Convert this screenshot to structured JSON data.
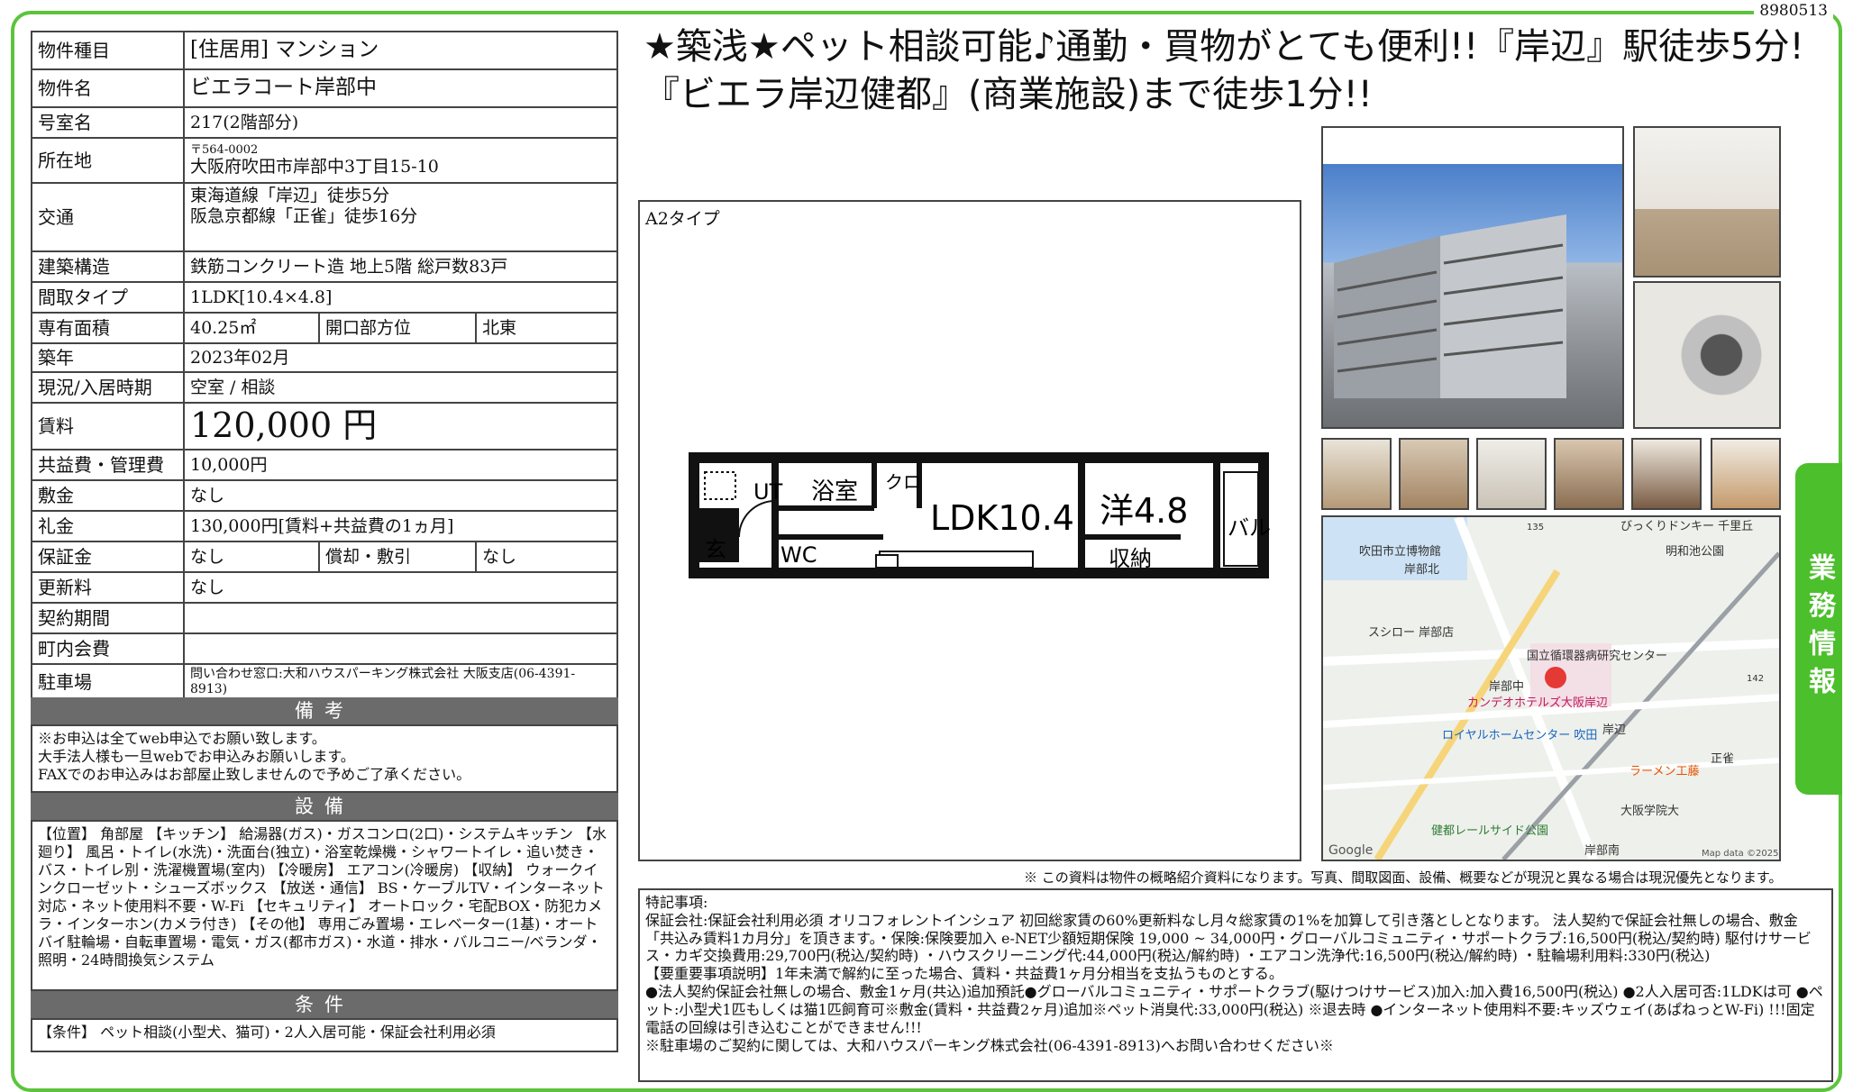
{
  "doc_id": "8980513",
  "headline": "★築浅★ペット相談可能♪通勤・買物がとても便利!!『岸辺』駅徒歩5分!『ビエラ岸辺健都』(商業施設)まで徒歩1分!!",
  "property": {
    "type_label": "物件種目",
    "type_value": "[住居用] マンション",
    "name_label": "物件名",
    "name_value": "ビエラコート岸部中",
    "room_label": "号室名",
    "room_value": "217(2階部分)",
    "address_label": "所在地",
    "postal": "〒564-0002",
    "address": "大阪府吹田市岸部中3丁目15-10",
    "transit_label": "交通",
    "transit_1": "東海道線「岸辺」徒歩5分",
    "transit_2": "阪急京都線「正雀」徒歩16分",
    "structure_label": "建築構造",
    "structure_value": "鉄筋コンクリート造 地上5階 総戸数83戸",
    "layout_label": "間取タイプ",
    "layout_value": "1LDK[10.4×4.8]",
    "area_label": "専有面積",
    "area_value": "40.25㎡",
    "orientation_label": "開口部方位",
    "orientation_value": "北東",
    "built_label": "築年",
    "built_value": "2023年02月",
    "status_label": "現況/入居時期",
    "status_value": "空室 / 相談",
    "rent_label": "賃料",
    "rent_value": "120,000 円",
    "fee_label": "共益費・管理費",
    "fee_value": "10,000円",
    "deposit_label": "敷金",
    "deposit_value": "なし",
    "key_money_label": "礼金",
    "key_money_value": "130,000円[賃料+共益費の1ヵ月]",
    "security_label": "保証金",
    "security_value": "なし",
    "amortization_label": "償却・敷引",
    "amortization_value": "なし",
    "renewal_label": "更新料",
    "renewal_value": "なし",
    "contract_label": "契約期間",
    "contract_value": "",
    "assoc_label": "町内会費",
    "assoc_value": "",
    "parking_label": "駐車場",
    "parking_value": "問い合わせ窓口:大和ハウスパーキング株式会社 大阪支店(06-4391-8913)"
  },
  "remarks_title": "備考",
  "remarks": [
    "※お申込は全てweb申込でお願い致します。",
    "大手法人様も一旦webでお申込みお願いします。",
    "FAXでのお申込みはお部屋止致しませんので予めご了承ください。"
  ],
  "facilities_title": "設備",
  "facilities": "【位置】 角部屋 【キッチン】 給湯器(ガス)・ガスコンロ(2口)・システムキッチン 【水廻り】 風呂・トイレ(水洗)・洗面台(独立)・浴室乾燥機・シャワートイレ・追い焚き・バス・トイレ別・洗濯機置場(室内) 【冷暖房】 エアコン(冷暖房) 【収納】 ウォークインクローゼット・シューズボックス 【放送・通信】 BS・ケーブルTV・インターネット対応・ネット使用料不要・W-Fi 【セキュリティ】 オートロック・宅配BOX・防犯カメラ・インターホン(カメラ付き) 【その他】 専用ごみ置場・エレベーター(1基)・オートバイ駐輪場・自転車置場・電気・ガス(都市ガス)・水道・排水・バルコニー/ベランダ・照明・24時間換気システム",
  "conditions_title": "条件",
  "conditions": "【条件】 ペット相談(小型犬、猫可)・2人入居可能・保証会社利用必須",
  "plan": {
    "type_label": "A2タイプ",
    "rooms": {
      "ut": "UT",
      "bath": "浴室",
      "closet": "クロ",
      "entry": "玄",
      "wc": "WC",
      "ldk": "LDK10.4",
      "western": "洋4.8",
      "storage": "収納",
      "balcony": "バル"
    }
  },
  "map": {
    "labels": [
      "びっくりドンキー 千里丘",
      "吹田市立博物館",
      "岸部北",
      "明和池公園",
      "スシロー 岸部店",
      "国立循環器病研究センター",
      "岸部中",
      "カンデオホテルズ大阪岸辺",
      "ロイヤルホームセンター 吹田",
      "岸辺",
      "正雀",
      "ラーメン工藤",
      "大阪学院大",
      "健都レールサイド公園",
      "岸部南",
      "Google",
      "Map data ©2025",
      "135",
      "142"
    ]
  },
  "disclaimer": "※ この資料は物件の概略紹介資料になります。写真、間取図面、設備、概要などが現況と異なる場合は現況優先となります。",
  "notes": [
    "特記事項:",
    "保証会社:保証会社利用必須 オリコフォレントインシュア 初回総家賃の60%更新料なし月々総家賃の1%を加算して引き落としとなります。 法人契約で保証会社無しの場合、敷金「共込み賃料1カ月分」を頂きます。・保険:保険要加入 e-NET少額短期保険 19,000 ~ 34,000円・グローバルコミュニティ・サポートクラブ:16,500円(税込/契約時) 駆付けサービス・カギ交換費用:29,700円(税込/契約時) ・ハウスクリーニング代:44,000円(税込/解約時) ・エアコン洗浄代:16,500円(税込/解約時) ・駐輪場利用料:330円(税込)",
    "【要重要事項説明】1年未満で解約に至った場合、賃料・共益費1ヶ月分相当を支払うものとする。",
    "●法人契約保証会社無しの場合、敷金1ヶ月(共込)追加預託●グローバルコミュニティ・サポートクラブ(駆けつけサービス)加入:加入費16,500円(税込) ●2人入居可否:1LDKは可 ●ペット:小型犬1匹もしくは猫1匹飼育可※敷金(賃料・共益費2ヶ月)追加※ペット消臭代:33,000円(税込) ※退去時 ●インターネット使用料不要:キッズウェイ(あぱねっとW-Fi) !!!固定電話の回線は引き込むことができません!!!",
    "※駐車場のご契約に関しては、大和ハウスパーキング株式会社(06-4391-8913)へお問い合わせください※"
  ],
  "side_tab": "業務情報"
}
